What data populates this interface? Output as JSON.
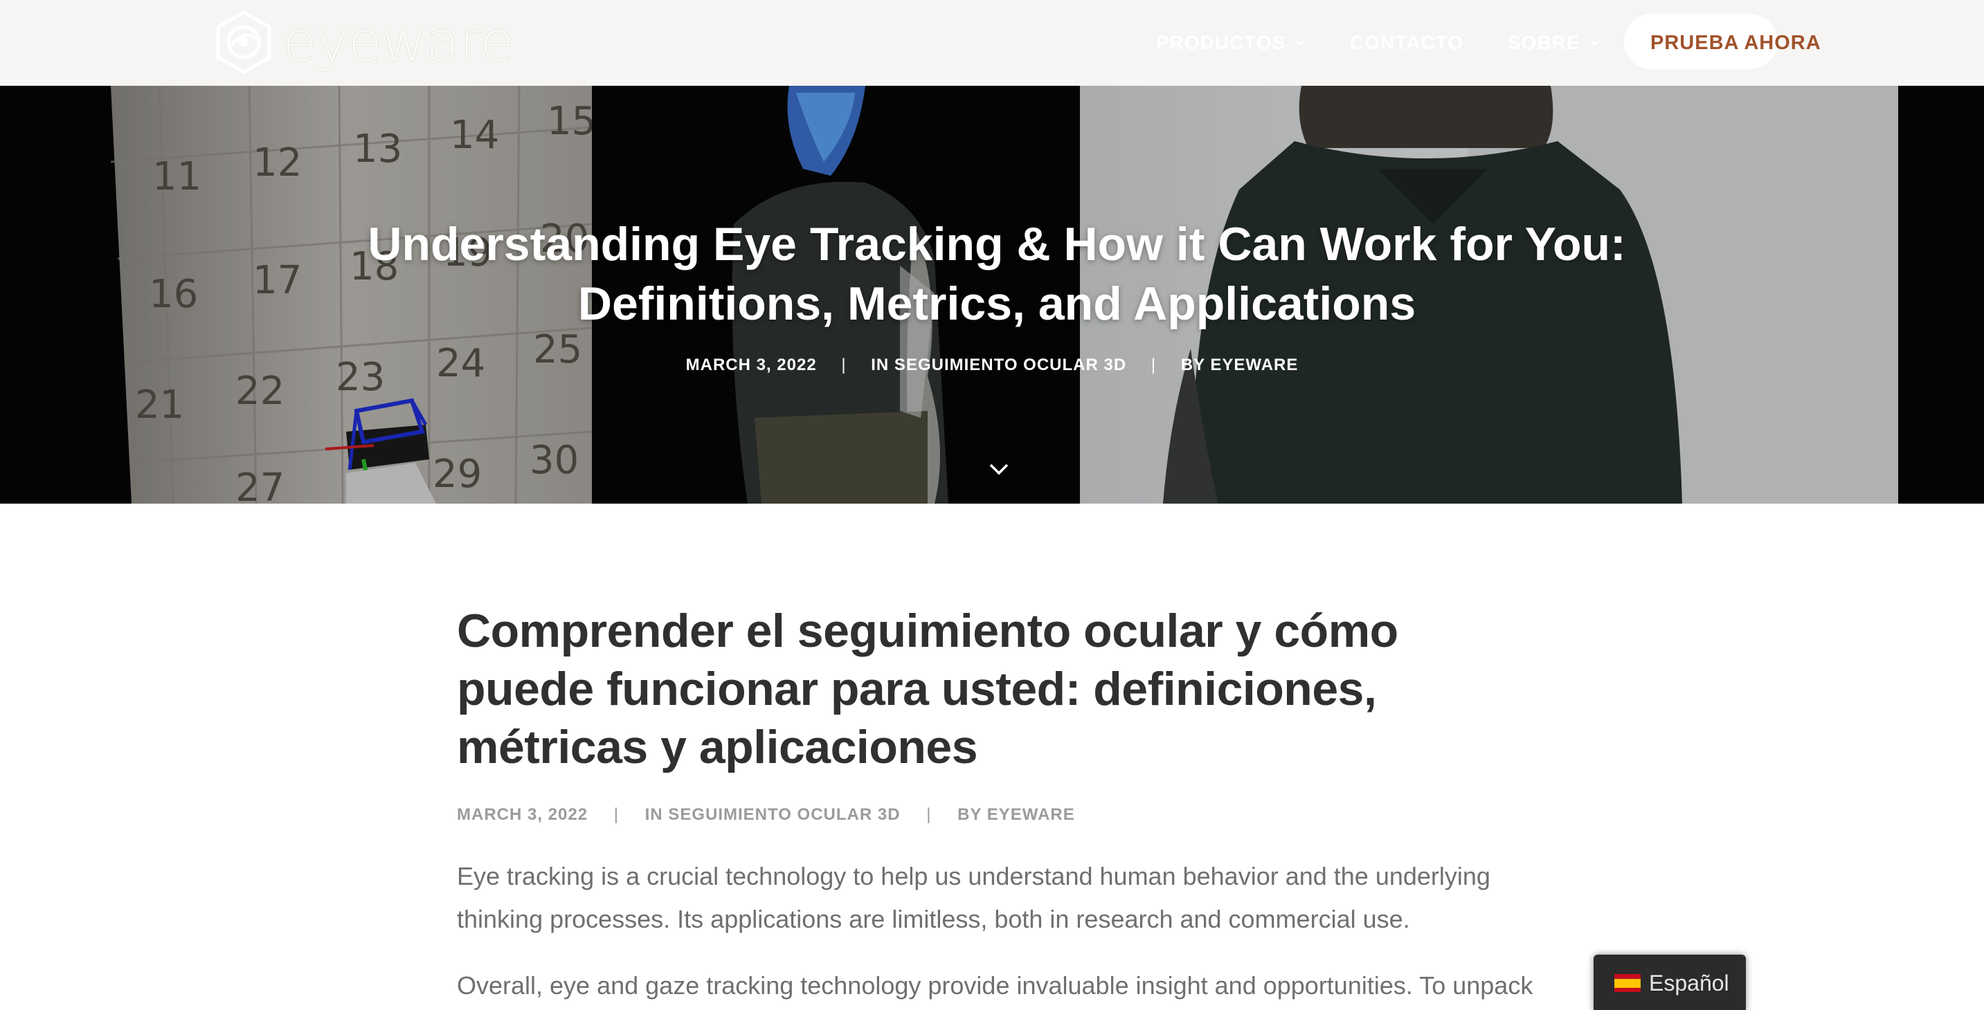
{
  "brand": {
    "logo_text": "eyeware"
  },
  "nav": {
    "items": [
      {
        "label": "PRODUCTOS",
        "has_dropdown": true
      },
      {
        "label": "CONTACTO",
        "has_dropdown": false
      },
      {
        "label": "SOBRE",
        "has_dropdown": true
      }
    ],
    "cta_label": "PRUEBA AHORA"
  },
  "hero": {
    "title": "Understanding Eye Tracking & How it Can Work for You: Definitions, Metrics, and Applications",
    "date": "MARCH 3, 2022",
    "category": "IN SEGUIMIENTO OCULAR 3D",
    "author": "BY EYEWARE",
    "separator": "|",
    "calibration_numbers": [
      "11",
      "12",
      "13",
      "14",
      "15",
      "16",
      "17",
      "18",
      "19",
      "20",
      "21",
      "22",
      "23",
      "24",
      "25",
      "27",
      "29",
      "30"
    ]
  },
  "article": {
    "title": "Comprender el seguimiento ocular y cómo puede funcionar para usted: definiciones, métricas y aplicaciones",
    "date": "MARCH 3, 2022",
    "category": "IN SEGUIMIENTO OCULAR 3D",
    "author": "BY EYEWARE",
    "separator": "|",
    "paragraphs": [
      "Eye tracking is a crucial technology to help us understand human behavior and the underlying thinking processes. Its applications are limitless, both in research and commercial use.",
      "Overall, eye and gaze tracking technology provide invaluable insight and opportunities. To unpack"
    ]
  },
  "language_switcher": {
    "label": "Español",
    "flag": "spain-flag-icon"
  },
  "colors": {
    "header_bg": "#f6f5f3",
    "accent": "#a1522b",
    "text_dark": "#303030",
    "text_meta": "#9b9b9b",
    "text_body": "#6f6f6f",
    "switcher_bg": "#2b2b2b"
  }
}
